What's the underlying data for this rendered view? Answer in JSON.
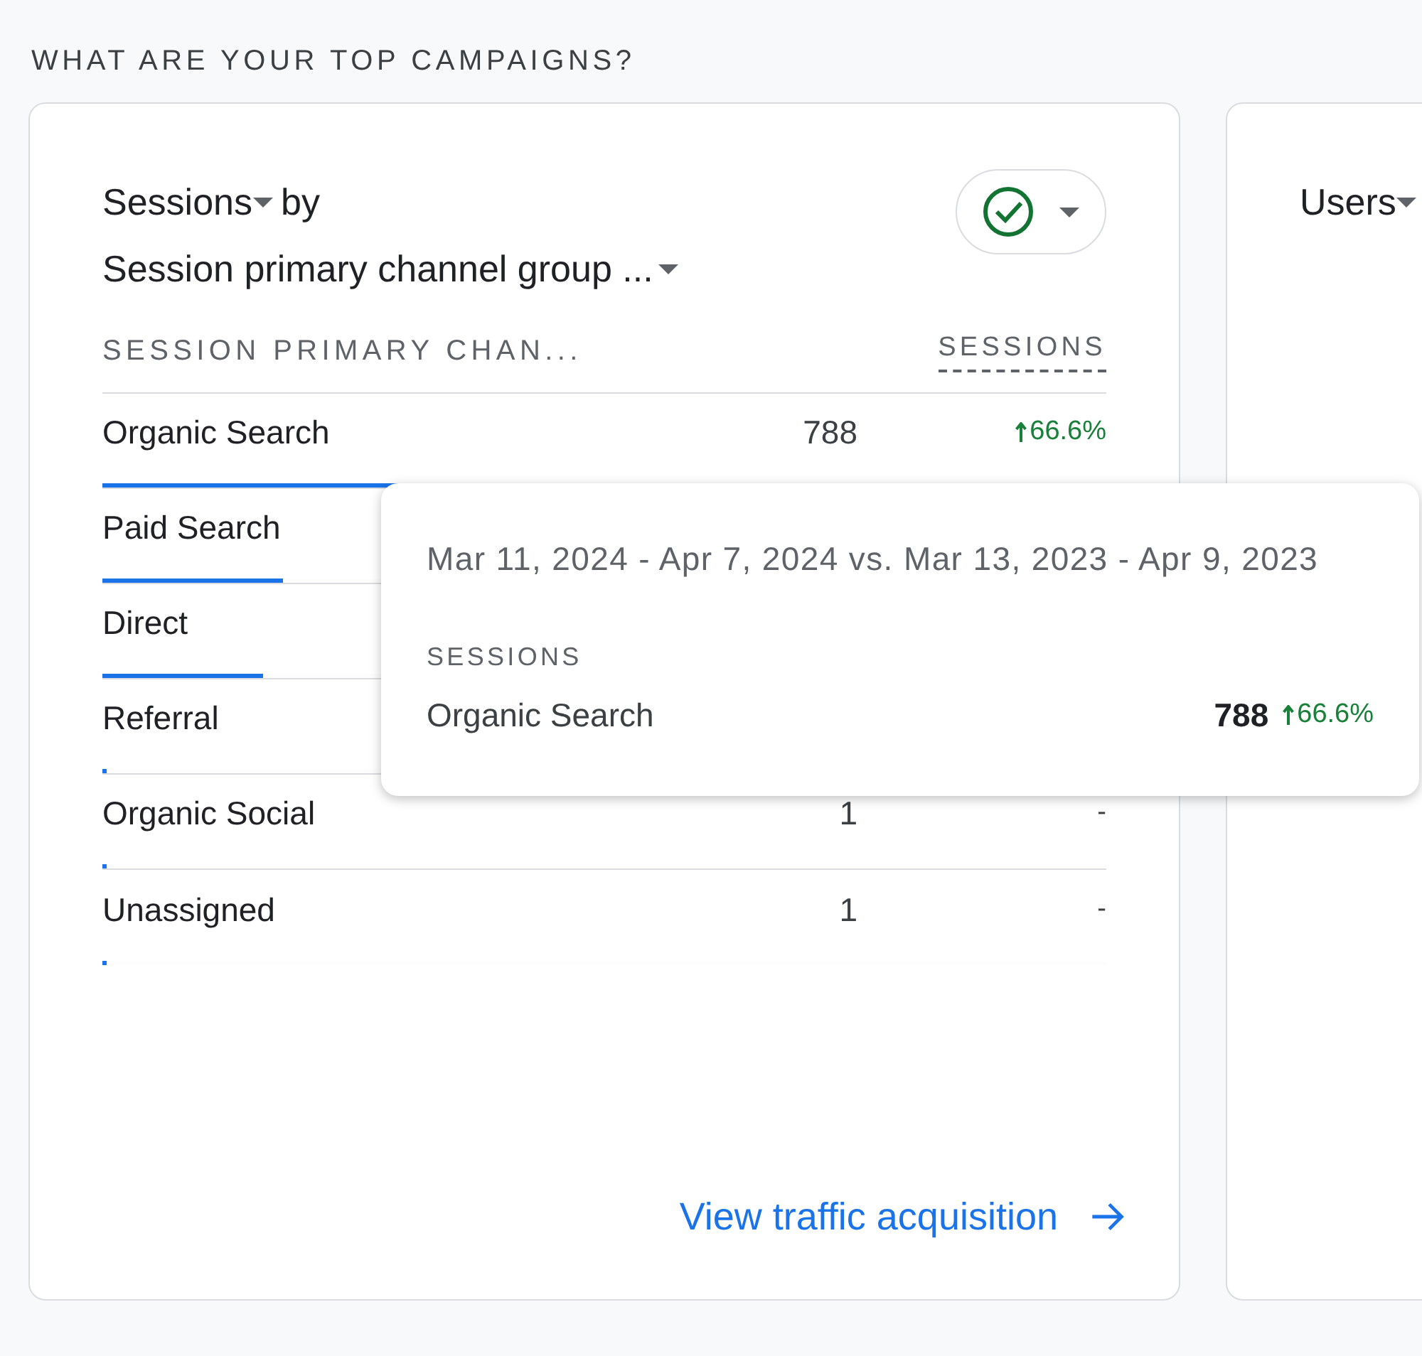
{
  "section_title": "WHAT ARE YOUR TOP CAMPAIGNS?",
  "card": {
    "metric": "Sessions",
    "by": "by",
    "dimension": "Session primary channel group ...",
    "status_ok": true,
    "columns": [
      "SESSION PRIMARY CHAN...",
      "SESSIONS"
    ],
    "rows": [
      {
        "name": "Organic Search",
        "value": "788",
        "change": "66.6%",
        "up": true,
        "level": 0.655
      },
      {
        "name": "Paid Search",
        "level": 0.18
      },
      {
        "name": "Direct",
        "level": 0.16
      },
      {
        "name": "Referral",
        "level": 0.004
      },
      {
        "name": "Organic Social",
        "value": "1",
        "change": "-",
        "up": false,
        "level": 0.004
      },
      {
        "name": "Unassigned",
        "value": "1",
        "change": "-",
        "up": false,
        "level": 0.004
      }
    ],
    "link": "View traffic acquisition"
  },
  "tooltip": {
    "dates": "Mar 11, 2024 - Apr 7, 2024 vs. Mar 13, 2023 - Apr 9, 2023",
    "metric": "SESSIONS",
    "name": "Organic Search",
    "value": "788",
    "change": "66.6%",
    "up": true
  },
  "second_card": {
    "metric": "Users"
  }
}
